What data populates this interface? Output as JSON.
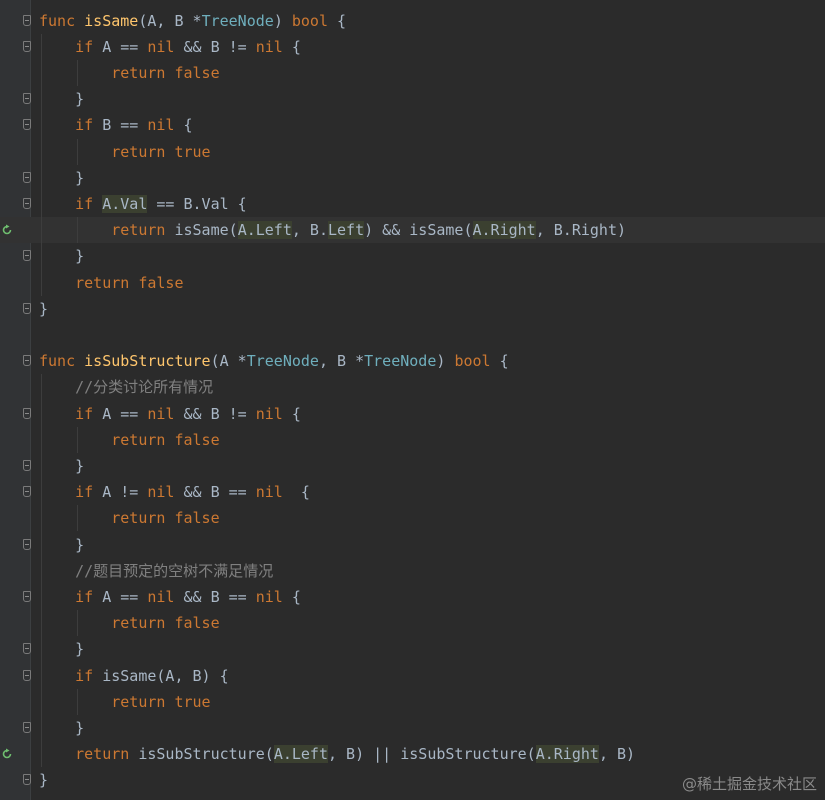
{
  "editor": {
    "lines": [
      [
        {
          "t": "func ",
          "c": "k"
        },
        {
          "t": "isSame",
          "c": "f"
        },
        {
          "t": "(A, B *"
        },
        {
          "t": "TreeNode",
          "c": "t"
        },
        {
          "t": ") "
        },
        {
          "t": "bool",
          "c": "k"
        },
        {
          "t": " {"
        }
      ],
      [
        {
          "t": "    "
        },
        {
          "t": "if",
          "c": "k"
        },
        {
          "t": " A == "
        },
        {
          "t": "nil",
          "c": "k"
        },
        {
          "t": " && B != "
        },
        {
          "t": "nil",
          "c": "k"
        },
        {
          "t": " {"
        }
      ],
      [
        {
          "t": "        "
        },
        {
          "t": "return false",
          "c": "k"
        }
      ],
      [
        {
          "t": "    }"
        }
      ],
      [
        {
          "t": "    "
        },
        {
          "t": "if",
          "c": "k"
        },
        {
          "t": " B == "
        },
        {
          "t": "nil",
          "c": "k"
        },
        {
          "t": " {"
        }
      ],
      [
        {
          "t": "        "
        },
        {
          "t": "return true",
          "c": "k"
        }
      ],
      [
        {
          "t": "    }"
        }
      ],
      [
        {
          "t": "    "
        },
        {
          "t": "if",
          "c": "k"
        },
        {
          "t": " "
        },
        {
          "t": "A.Val",
          "h": 1
        },
        {
          "t": " == B.Val {"
        }
      ],
      [
        {
          "t": "        "
        },
        {
          "t": "return",
          "c": "k"
        },
        {
          "t": " isSame("
        },
        {
          "t": "A.Left",
          "h": 1
        },
        {
          "t": ", B."
        },
        {
          "t": "Left",
          "h": 1
        },
        {
          "t": ") && isSame("
        },
        {
          "t": "A.Right",
          "h": 1
        },
        {
          "t": ", B.Right)"
        }
      ],
      [
        {
          "t": "    }"
        }
      ],
      [
        {
          "t": "    "
        },
        {
          "t": "return false",
          "c": "k"
        }
      ],
      [
        {
          "t": "}"
        }
      ],
      [],
      [
        {
          "t": "func ",
          "c": "k"
        },
        {
          "t": "isSubStructure",
          "c": "f"
        },
        {
          "t": "(A *"
        },
        {
          "t": "TreeNode",
          "c": "t"
        },
        {
          "t": ", B *"
        },
        {
          "t": "TreeNode",
          "c": "t"
        },
        {
          "t": ") "
        },
        {
          "t": "bool",
          "c": "k"
        },
        {
          "t": " {"
        }
      ],
      [
        {
          "t": "    "
        },
        {
          "t": "//分类讨论所有情况",
          "c": "c"
        }
      ],
      [
        {
          "t": "    "
        },
        {
          "t": "if",
          "c": "k"
        },
        {
          "t": " A == "
        },
        {
          "t": "nil",
          "c": "k"
        },
        {
          "t": " && B != "
        },
        {
          "t": "nil",
          "c": "k"
        },
        {
          "t": " {"
        }
      ],
      [
        {
          "t": "        "
        },
        {
          "t": "return false",
          "c": "k"
        }
      ],
      [
        {
          "t": "    }"
        }
      ],
      [
        {
          "t": "    "
        },
        {
          "t": "if",
          "c": "k"
        },
        {
          "t": " A != "
        },
        {
          "t": "nil",
          "c": "k"
        },
        {
          "t": " && B == "
        },
        {
          "t": "nil",
          "c": "k"
        },
        {
          "t": "  {"
        }
      ],
      [
        {
          "t": "        "
        },
        {
          "t": "return false",
          "c": "k"
        }
      ],
      [
        {
          "t": "    }"
        }
      ],
      [
        {
          "t": "    "
        },
        {
          "t": "//题目预定的空树不满足情况",
          "c": "c"
        }
      ],
      [
        {
          "t": "    "
        },
        {
          "t": "if",
          "c": "k"
        },
        {
          "t": " A == "
        },
        {
          "t": "nil",
          "c": "k"
        },
        {
          "t": " && B == "
        },
        {
          "t": "nil",
          "c": "k"
        },
        {
          "t": " {"
        }
      ],
      [
        {
          "t": "        "
        },
        {
          "t": "return false",
          "c": "k"
        }
      ],
      [
        {
          "t": "    }"
        }
      ],
      [
        {
          "t": "    "
        },
        {
          "t": "if",
          "c": "k"
        },
        {
          "t": " isSame(A, B) {"
        }
      ],
      [
        {
          "t": "        "
        },
        {
          "t": "return true",
          "c": "k"
        }
      ],
      [
        {
          "t": "    }"
        }
      ],
      [
        {
          "t": "    "
        },
        {
          "t": "return",
          "c": "k"
        },
        {
          "t": " isSubStructure("
        },
        {
          "t": "A.Left",
          "h": 1
        },
        {
          "t": ", B) || isSubStructure("
        },
        {
          "t": "A.Right",
          "h": 1
        },
        {
          "t": ", B)"
        }
      ],
      [
        {
          "t": "}"
        }
      ]
    ],
    "recursive_call_lines": [
      8,
      28
    ],
    "current_line": 8
  },
  "watermark": "@稀土掘金技术社区"
}
